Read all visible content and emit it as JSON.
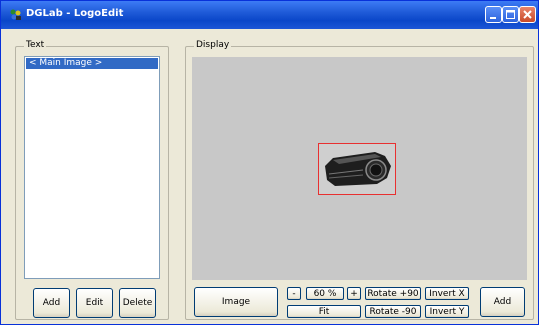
{
  "window": {
    "title": "DGLab  -  LogoEdit",
    "accent": "#0a46c9"
  },
  "text_panel": {
    "label": "Text",
    "items": [
      "< Main Image >"
    ],
    "buttons": {
      "add": "Add",
      "edit": "Edit",
      "delete": "Delete"
    }
  },
  "display_panel": {
    "label": "Display",
    "selection_color": "#e83030"
  },
  "toolbar": {
    "image": "Image",
    "zoom_out": "-",
    "zoom_value": "60 %",
    "zoom_in": "+",
    "fit": "Fit",
    "rotate_pos": "Rotate +90",
    "rotate_neg": "Rotate -90",
    "invert_x": "Invert X",
    "invert_y": "Invert Y",
    "add": "Add"
  },
  "icons": [
    "app-icon",
    "minimize-icon",
    "maximize-icon",
    "close-icon"
  ]
}
